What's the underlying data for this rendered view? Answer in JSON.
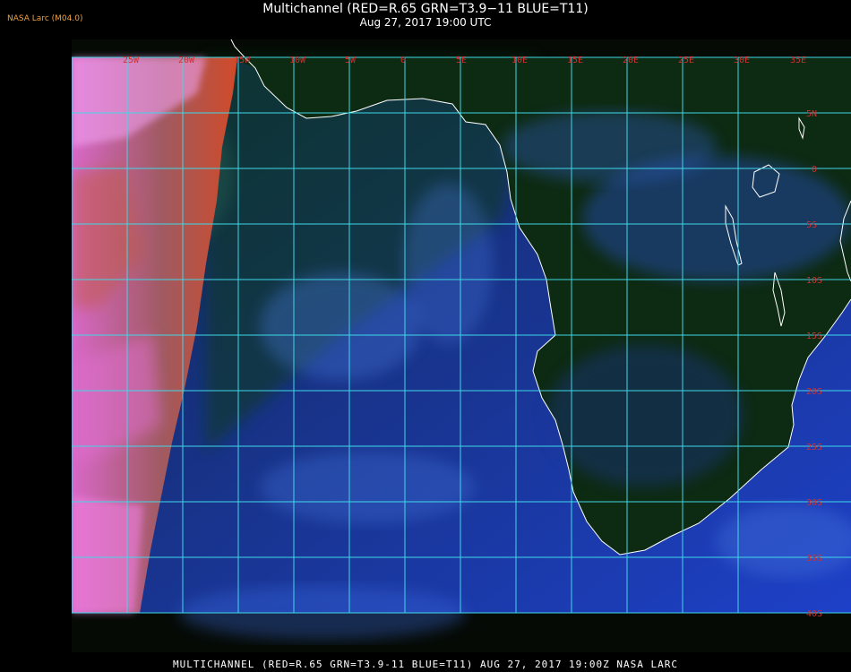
{
  "header": {
    "credit": "NASA Larc (M04.0)",
    "title": "Multichannel (RED=R.65 GRN=T3.9−11 BLUE=T11)",
    "datetime": "Aug 27, 2017 19:00 UTC"
  },
  "footer": {
    "caption": "MULTICHANNEL (RED=R.65 GRN=T3.9-11 BLUE=T11) AUG 27, 2017 19:00Z   NASA LARC"
  },
  "map": {
    "grid_color": "#40d8e8",
    "coast_color": "#ffffff",
    "label_color": "#d03030",
    "lon_labels": [
      "25W",
      "20W",
      "15W",
      "10W",
      "5W",
      "0",
      "5E",
      "10E",
      "15E",
      "20E",
      "25E",
      "30E",
      "35E"
    ],
    "lat_labels": [
      "5N",
      "0",
      "5S",
      "10S",
      "15S",
      "20S",
      "25S",
      "30S",
      "35S",
      "40S"
    ],
    "colors": {
      "ocean_blue": "#1c3cb8",
      "land_green": "#0e2a10",
      "night_limb_pink": "#e070d0",
      "terminator_red": "#c84a28",
      "cloud_cyan": "#5a90ff"
    }
  }
}
